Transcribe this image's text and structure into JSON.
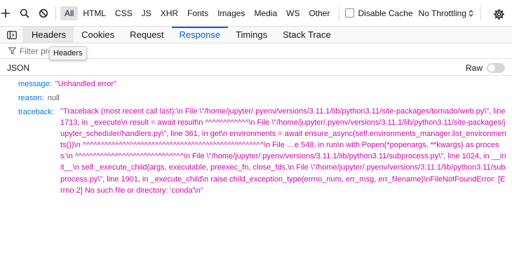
{
  "toolbar": {
    "filters": [
      "All",
      "HTML",
      "CSS",
      "JS",
      "XHR",
      "Fonts",
      "Images",
      "Media",
      "WS",
      "Other"
    ],
    "active_filter": "All",
    "disable_cache_label": "Disable Cache",
    "throttling_label": "No Throttling"
  },
  "tabs": [
    "Headers",
    "Cookies",
    "Request",
    "Response",
    "Timings",
    "Stack Trace"
  ],
  "selected_tab": "Response",
  "filter_placeholder": "Filter properties",
  "tooltip": "Headers",
  "json_header": {
    "title": "JSON",
    "raw_label": "Raw"
  },
  "json": {
    "message_key": "message:",
    "message_value": "\"Unhandled error\"",
    "reason_key": "reason:",
    "reason_value": "null",
    "traceback_key": "traceback:",
    "traceback_value": "\"Traceback (most recent call last):\\n File \\\"/home/jupyter/.pyenv/versions/3.11.1/lib/python3.11/site-packages/tornado/web.py\\\", line 1713, in _execute\\n result = await result\\n ^^^^^^^^^^^^\\n File \\\"/home/jupyter/.pyenv/versions/3.11.1/lib/python3.11/site-packages/jupyter_scheduler/handlers.py\\\", line 361, in get\\n environments = await ensure_async(self.environments_manager.list_environments())\\n ^^^^^^^^^^^^^^^^^^^^^^^^^^^^^^^^^^^^^^^^^^^^^^^^^^\\n File …e 548, in run\\n with Popen(*popenargs, **kwargs) as process:\\n ^^^^^^^^^^^^^^^^^^^^^^^^^^^^^^\\n File \\\"/home/jupyter/.pyenv/versions/3.11.1/lib/python3.11/subprocess.py\\\", line 1024, in __init__\\n self._execute_child(args, executable, preexec_fn, close_fds,\\n File \\\"/home/jupyter/.pyenv/versions/3.11.1/lib/python3.11/subprocess.py\\\", line 1901, in _execute_child\\n raise child_exception_type(errno_num, err_msg, err_filename)\\nFileNotFoundError: [Errno 2] No such file or directory: 'conda'\\n\""
  },
  "colors": {
    "accent": "#0061e0",
    "key": "#0074e8",
    "string": "#dd00a9"
  }
}
